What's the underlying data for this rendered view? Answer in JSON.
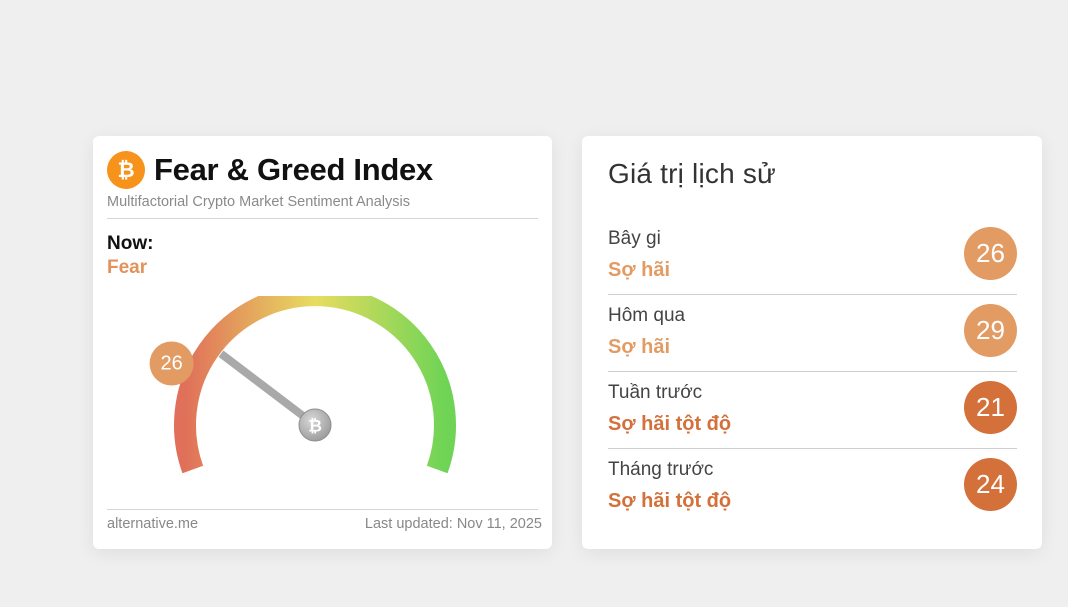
{
  "fng": {
    "title": "Fear & Greed Index",
    "subtitle": "Multifactorial Crypto Market Sentiment Analysis",
    "now_label": "Now:",
    "now_value": "Fear",
    "value": "26",
    "value_fraction": 0.26,
    "footer_left": "alternative.me",
    "footer_right": "Last updated: Nov 11, 2025",
    "icon": "bitcoin-icon"
  },
  "history": {
    "title": "Giá trị lịch sử",
    "rows": [
      {
        "label": "Bây gi",
        "classification": "Sợ hãi",
        "value": "26",
        "color": "#e39b64"
      },
      {
        "label": "Hôm qua",
        "classification": "Sợ hãi",
        "value": "29",
        "color": "#e39b64"
      },
      {
        "label": "Tuần trước",
        "classification": "Sợ hãi tột độ",
        "value": "21",
        "color": "#d4703a"
      },
      {
        "label": "Tháng trước",
        "classification": "Sợ hãi tột độ",
        "value": "24",
        "color": "#d4703a"
      }
    ]
  },
  "colors": {
    "fear": "#e0935a",
    "extreme_fear": "#d4703a",
    "bitcoin": "#f7931a",
    "gauge_start": "#e0705a",
    "gauge_mid": "#e8dc60",
    "gauge_end": "#6fd455"
  }
}
